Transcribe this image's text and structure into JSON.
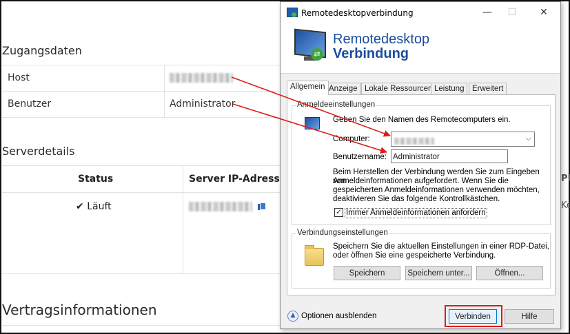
{
  "page": {
    "zugang_title": "Zugangsdaten",
    "host_label": "Host",
    "benutzer_label": "Benutzer",
    "benutzer_value": "Administrator",
    "server_title": "Serverdetails",
    "col_status": "Status",
    "col_ip": "Server IP-Adresse",
    "status_value": "Läuft",
    "vertrag_title": "Vertragsinformationen",
    "edge_pu": "PU",
    "edge_ke": "Ke"
  },
  "dialog": {
    "window_title": "Remotedesktopverbindung",
    "banner_line1": "Remotedesktop",
    "banner_line2": "Verbindung",
    "tabs": [
      "Allgemein",
      "Anzeige",
      "Lokale Ressourcen",
      "Leistung",
      "Erweitert"
    ],
    "anmelde_legend": "Anmeldeeinstellungen",
    "anmelde_intro": "Geben Sie den Namen des Remotecomputers ein.",
    "computer_label": "Computer:",
    "benutzername_label": "Benutzername:",
    "benutzername_value": "Administrator",
    "info_text_lines": [
      "Beim Herstellen der Verbindung werden Sie zum Eingeben von",
      "Anmeldeinformationen aufgefordert. Wenn Sie die",
      "gespeicherten Anmeldeinformationen verwenden möchten,",
      "deaktivieren Sie das folgende Kontrollkästchen."
    ],
    "checkbox_label": "Immer Anmeldeinformationen anfordern",
    "checkbox_checked": true,
    "verbindung_legend": "Verbindungseinstellungen",
    "verbindung_text_lines": [
      "Speichern Sie die aktuellen Einstellungen in einer RDP-Datei,",
      "oder öffnen Sie eine gespeicherte Verbindung."
    ],
    "btn_speichern": "Speichern",
    "btn_speichern_unter": "Speichern unter...",
    "btn_oeffnen": "Öffnen...",
    "optionen_label": "Optionen ausblenden",
    "btn_verbinden": "Verbinden",
    "btn_hilfe": "Hilfe"
  },
  "colors": {
    "banner_text": "#1a4c9c",
    "highlight": "#d71d1d"
  }
}
